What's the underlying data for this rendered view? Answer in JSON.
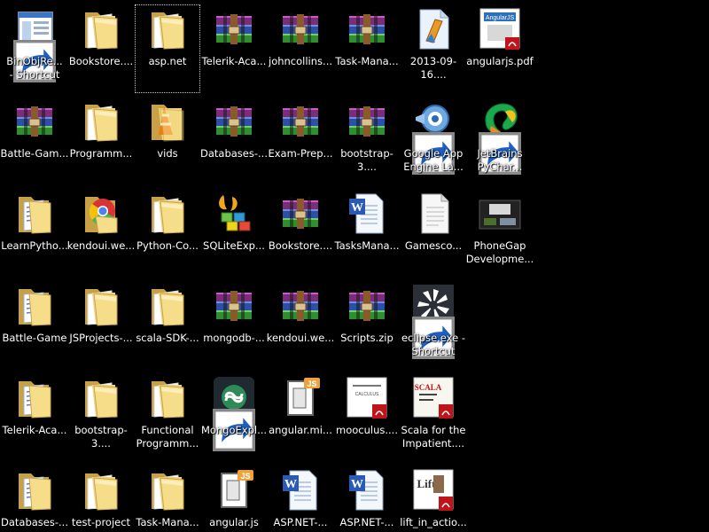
{
  "desktop": {
    "icons": [
      {
        "label": "BinObjRe...\n- Shortcut",
        "type": "app-window",
        "shortcut": true
      },
      {
        "label": "Bookstore....",
        "type": "folder"
      },
      {
        "label": "asp.net",
        "type": "folder",
        "selected": true
      },
      {
        "label": "Telerik-Aca...",
        "type": "rar"
      },
      {
        "label": "johncollins...",
        "type": "rar"
      },
      {
        "label": "Task-Mana...",
        "type": "rar"
      },
      {
        "label": "2013-09-16....",
        "type": "file-blue"
      },
      {
        "label": "angularjs.pdf",
        "type": "pdf-book"
      },
      {
        "label": "Battle-Gam...",
        "type": "rar"
      },
      {
        "label": "Programm...",
        "type": "folder"
      },
      {
        "label": "vids",
        "type": "folder-vlc"
      },
      {
        "label": "Databases-...",
        "type": "rar"
      },
      {
        "label": "Exam-Prep...",
        "type": "rar"
      },
      {
        "label": "bootstrap-3....",
        "type": "rar"
      },
      {
        "label": "Google App\nEngine La...",
        "type": "gae",
        "shortcut": true
      },
      {
        "label": "JetBrains\nPyChar...",
        "type": "pycharm",
        "shortcut": true
      },
      {
        "label": "LearnPytho...",
        "type": "folder-doc"
      },
      {
        "label": "kendoui.we...",
        "type": "folder-chrome"
      },
      {
        "label": "Python-Co...",
        "type": "folder"
      },
      {
        "label": "SQLiteExp...",
        "type": "sqlite"
      },
      {
        "label": "Bookstore....",
        "type": "rar"
      },
      {
        "label": "TasksMana...",
        "type": "word"
      },
      {
        "label": "Gamesco...",
        "type": "blank-file"
      },
      {
        "label": "PhoneGap\nDevelopme...",
        "type": "video-thumb"
      },
      {
        "label": "Battle-Game",
        "type": "folder-doc"
      },
      {
        "label": "JSProjects-...",
        "type": "folder"
      },
      {
        "label": "scala-SDK-...",
        "type": "folder"
      },
      {
        "label": "mongodb-...",
        "type": "rar"
      },
      {
        "label": "kendoui.we...",
        "type": "rar"
      },
      {
        "label": "Scripts.zip",
        "type": "rar"
      },
      {
        "label": "eclipse.exe -\nShortcut",
        "type": "eclipse",
        "shortcut": true
      },
      {
        "label": "",
        "type": "empty"
      },
      {
        "label": "Telerik-Aca...",
        "type": "folder-doc"
      },
      {
        "label": "bootstrap-3....",
        "type": "folder"
      },
      {
        "label": "Functional\nProgramm...",
        "type": "folder"
      },
      {
        "label": "MongoExpl...",
        "type": "mongo",
        "shortcut": true
      },
      {
        "label": "angular.mi...",
        "type": "js-file"
      },
      {
        "label": "mooculus....",
        "type": "pdf-doc"
      },
      {
        "label": "Scala for the\nImpatient....",
        "type": "pdf-scala"
      },
      {
        "label": "",
        "type": "empty"
      },
      {
        "label": "Databases-...",
        "type": "folder-doc"
      },
      {
        "label": "test-project",
        "type": "folder"
      },
      {
        "label": "Task-Mana...",
        "type": "folder"
      },
      {
        "label": "angular.js",
        "type": "js-file"
      },
      {
        "label": "ASP.NET-...",
        "type": "word"
      },
      {
        "label": "ASP.NET-...",
        "type": "word"
      },
      {
        "label": "lift_in_actio...",
        "type": "pdf-lift"
      },
      {
        "label": "",
        "type": "empty"
      }
    ]
  }
}
